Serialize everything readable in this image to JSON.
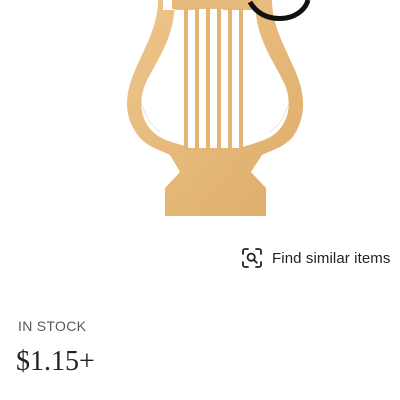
{
  "product": {
    "image_icon": "lyre-ornament",
    "wood_color": "#E8BD80",
    "stock_status": "IN STOCK",
    "price": "$1.15+"
  },
  "actions": {
    "find_similar_label": "Find similar items",
    "find_similar_icon": "visual-search-icon"
  }
}
